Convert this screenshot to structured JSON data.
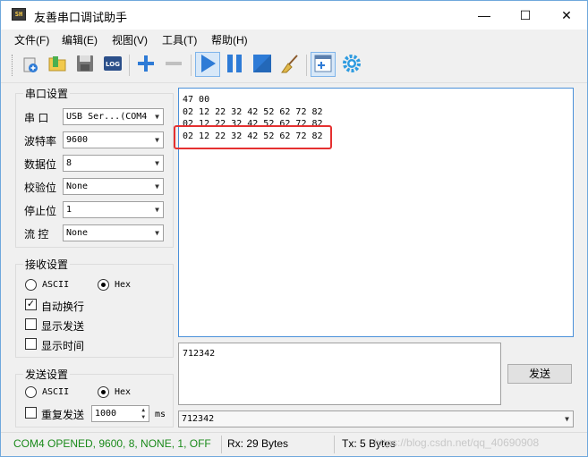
{
  "window": {
    "title": "友善串口调试助手",
    "app_icon_text": "SH"
  },
  "window_controls": {
    "minimize": "—",
    "maximize": "☐",
    "close": "✕"
  },
  "menu": [
    "文件(F)",
    "编辑(E)",
    "视图(V)",
    "工具(T)",
    "帮助(H)"
  ],
  "toolbar": {
    "log_label": "LOG",
    "icons": [
      "new-file-icon",
      "open-folder-icon",
      "save-icon",
      "log-icon",
      "add-icon",
      "remove-icon",
      "play-icon",
      "pause-icon",
      "stop-icon",
      "broom-icon",
      "add-window-icon",
      "gear-icon"
    ]
  },
  "serial_settings": {
    "title": "串口设置",
    "port_label": "串  口",
    "port_value": "USB Ser...(COM4",
    "baud_label": "波特率",
    "baud_value": "9600",
    "data_bits_label": "数据位",
    "data_bits_value": "8",
    "parity_label": "校验位",
    "parity_value": "None",
    "stop_bits_label": "停止位",
    "stop_bits_value": "1",
    "flow_label": "流  控",
    "flow_value": "None"
  },
  "receive_settings": {
    "title": "接收设置",
    "ascii_label": "ASCII",
    "hex_label": "Hex",
    "hex_selected": true,
    "auto_wrap_label": "自动换行",
    "auto_wrap_checked": true,
    "show_send_label": "显示发送",
    "show_send_checked": false,
    "show_time_label": "显示时间",
    "show_time_checked": false
  },
  "send_settings": {
    "title": "发送设置",
    "ascii_label": "ASCII",
    "hex_label": "Hex",
    "hex_selected": true,
    "repeat_label": "重复发送",
    "repeat_checked": false,
    "interval_value": "1000",
    "interval_unit": "ms"
  },
  "receive_area": {
    "lines": [
      "47 00",
      "02 12 22 32 42 52 62 72 82",
      "02 12 22 32 42 52 62 72 82",
      "02 12 22 32 42 52 62 72 82"
    ],
    "highlight_color": "#e53030"
  },
  "send_area": {
    "text": "712342",
    "button_label": "发送",
    "history_value": "712342"
  },
  "status": {
    "connection": "COM4 OPENED, 9600, 8, NONE, 1, OFF",
    "connection_color": "#1a8a1a",
    "rx": "Rx: 29 Bytes",
    "tx": "Tx: 5 Bytes",
    "watermark": "https://blog.csdn.net/qq_40690908"
  }
}
